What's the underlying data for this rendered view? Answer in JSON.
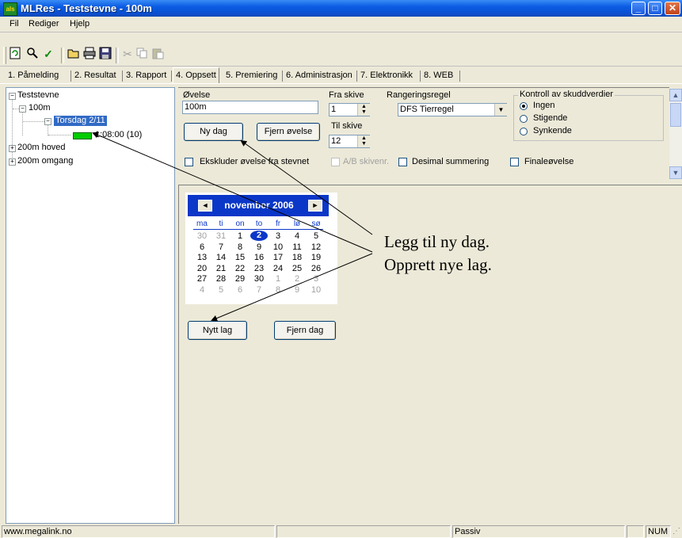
{
  "window": {
    "title": "MLRes - Teststevne - 100m",
    "logo_text": "aIs"
  },
  "menu": [
    "Fil",
    "Rediger",
    "Hjelp"
  ],
  "tabs": [
    "1. Påmelding",
    "2. Resultat",
    "3. Rapport",
    "4. Oppsett",
    "5. Premiering",
    "6. Administrasjon",
    "7. Elektronikk",
    "8. WEB"
  ],
  "tree": {
    "root": "Teststevne",
    "event": "100m",
    "day": "Torsdag 2/11",
    "heat": "1:08:00  (10)",
    "other_events": [
      "200m hoved",
      "200m omgang"
    ]
  },
  "form": {
    "ovelse_label": "Øvelse",
    "ovelse_value": "100m",
    "fra_skive_label": "Fra skive",
    "fra_skive_value": "1",
    "til_skive_label": "Til skive",
    "til_skive_value": "12",
    "rangeringsregel_label": "Rangeringsregel",
    "rangeringsregel_value": "DFS Tierregel",
    "ny_dag": "Ny dag",
    "fjern_ovelse": "Fjern øvelse",
    "ekskluder": "Ekskluder øvelse fra stevnet",
    "ab_skivenr": "A/B skivenr.",
    "desimal": "Desimal summering",
    "finaleovelse": "Finaleøvelse",
    "kontroll_label": "Kontroll av skuddverdier",
    "kontroll_options": [
      "Ingen",
      "Stigende",
      "Synkende"
    ]
  },
  "calendar": {
    "title": "november 2006",
    "prev": "◄",
    "next": "►",
    "weekdays": [
      "ma",
      "ti",
      "on",
      "to",
      "fr",
      "lø",
      "sø"
    ],
    "weeks": [
      [
        "30",
        "31",
        "1",
        "2",
        "3",
        "4",
        "5"
      ],
      [
        "6",
        "7",
        "8",
        "9",
        "10",
        "11",
        "12"
      ],
      [
        "13",
        "14",
        "15",
        "16",
        "17",
        "18",
        "19"
      ],
      [
        "20",
        "21",
        "22",
        "23",
        "24",
        "25",
        "26"
      ],
      [
        "27",
        "28",
        "29",
        "30",
        "1",
        "2",
        "3"
      ],
      [
        "4",
        "5",
        "6",
        "7",
        "8",
        "9",
        "10"
      ]
    ],
    "selected": "2"
  },
  "buttons": {
    "nytt_lag": "Nytt lag",
    "fjern_dag": "Fjern dag"
  },
  "annotations": [
    "Legg til ny dag.",
    "Opprett nye lag."
  ],
  "status": {
    "url": "www.megalink.no",
    "mode": "Passiv",
    "num": "NUM"
  },
  "colors": {
    "titlebar": "#0b5ce3",
    "calendar_header": "#0b37c8",
    "heat_indicator": "#00cc00"
  }
}
